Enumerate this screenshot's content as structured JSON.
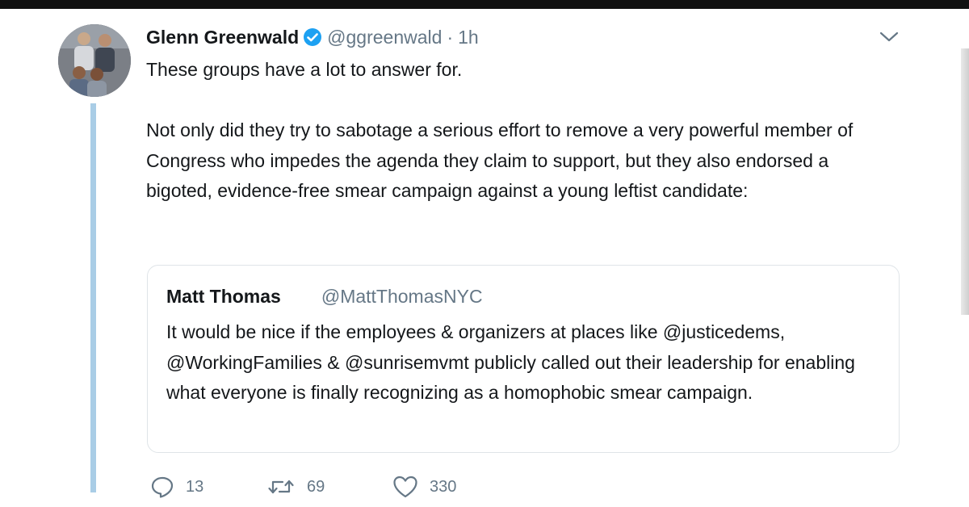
{
  "tweet": {
    "author": {
      "name": "Glenn Greenwald",
      "handle": "@ggreenwald",
      "separator": "·",
      "time": "1h"
    },
    "paragraphs": [
      "These groups have a lot to answer for.",
      "Not only did they try to sabotage a serious effort to remove a very powerful member of Congress who impedes the agenda they claim to support, but they also endorsed a bigoted, evidence-free smear campaign against a young leftist candidate:"
    ],
    "quoted": {
      "name": "Matt Thomas",
      "handle": "@MattThomasNYC",
      "text": "It would be nice if the employees & organizers at places like @justicedems, @WorkingFamilies & @sunrisemvmt publicly called out their leadership for enabling what everyone is finally recognizing as a homophobic smear campaign."
    },
    "actions": {
      "reply_count": "13",
      "retweet_count": "69",
      "like_count": "330"
    }
  },
  "icons": {
    "verified": "verified-badge-icon",
    "caret": "chevron-down-icon",
    "reply": "reply-icon",
    "retweet": "retweet-icon",
    "like": "heart-icon"
  },
  "colors": {
    "verified": "#1da1f2",
    "thread_line": "#a9cde6",
    "secondary_text": "#657786"
  }
}
